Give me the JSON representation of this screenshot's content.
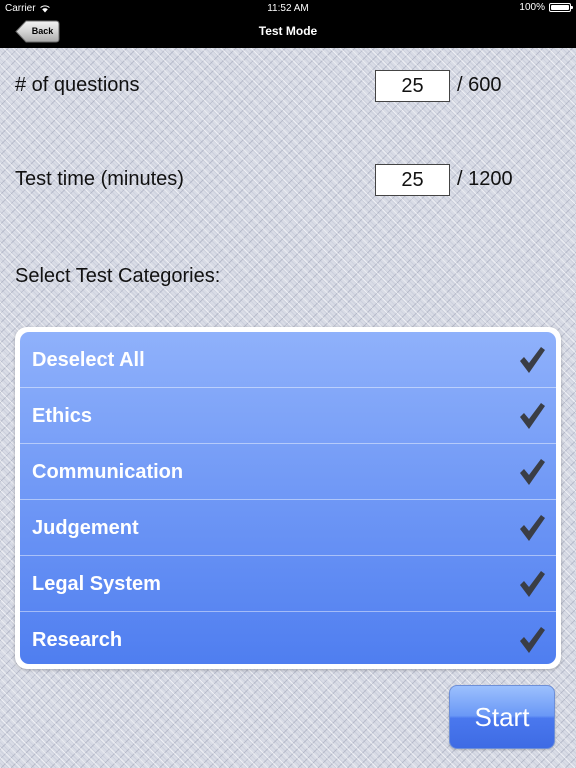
{
  "status_bar": {
    "carrier": "Carrier",
    "time": "11:52 AM",
    "battery": "100%"
  },
  "nav": {
    "title": "Test Mode",
    "back_label": "Back"
  },
  "questions": {
    "label": "# of questions",
    "value": "25",
    "max": "/ 600"
  },
  "test_time": {
    "label": "Test time (minutes)",
    "value": "25",
    "max": "/ 1200"
  },
  "categories_heading": "Select Test Categories:",
  "categories": [
    {
      "label": "Deselect All",
      "checked": true
    },
    {
      "label": "Ethics",
      "checked": true
    },
    {
      "label": "Communication",
      "checked": true
    },
    {
      "label": "Judgement",
      "checked": true
    },
    {
      "label": "Legal System",
      "checked": true
    },
    {
      "label": "Research",
      "checked": true
    }
  ],
  "start_label": "Start",
  "colors": {
    "panel_top": "#8fb1fb",
    "panel_bottom": "#4f7ef0",
    "checkmark": "#3a3d45"
  }
}
